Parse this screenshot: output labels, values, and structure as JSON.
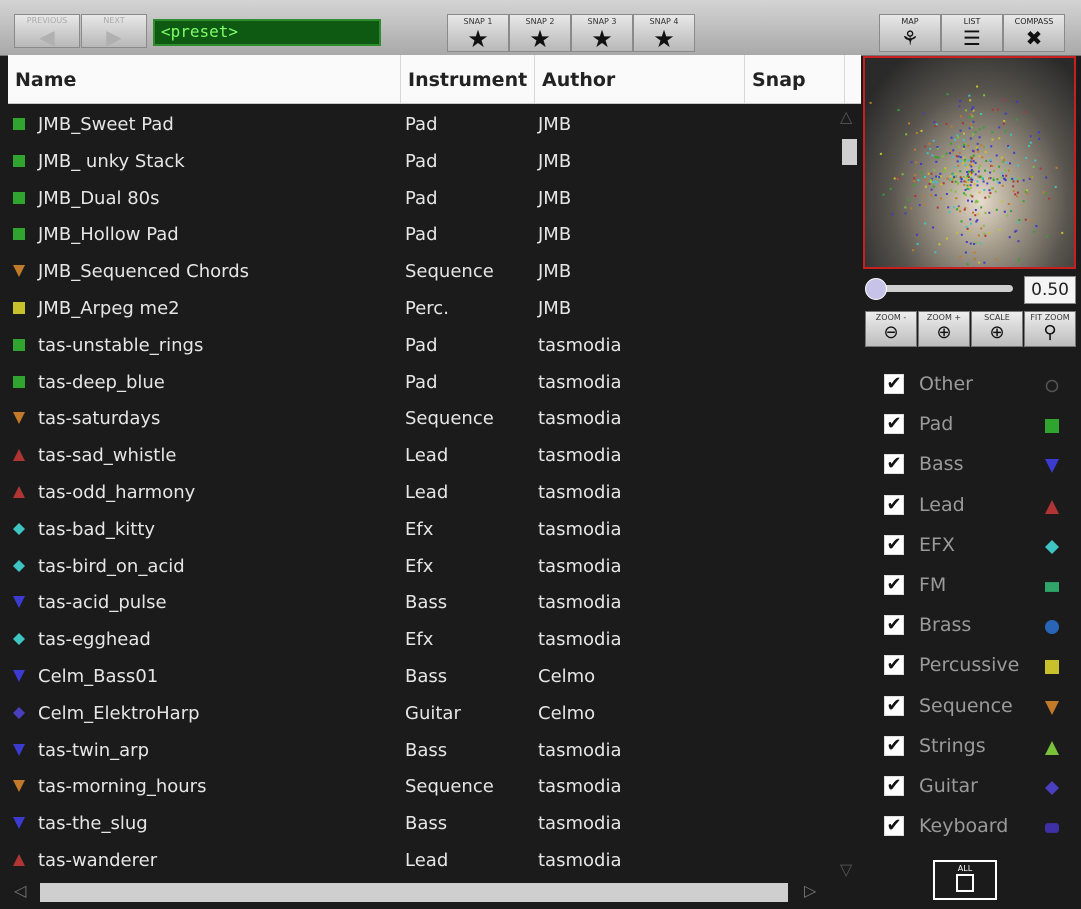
{
  "toolbar": {
    "previous_label": "PREVIOUS",
    "next_label": "NEXT",
    "preset_value": "<preset>",
    "snaps": [
      "SNAP 1",
      "SNAP 2",
      "SNAP 3",
      "SNAP 4"
    ],
    "views": [
      "MAP",
      "LIST",
      "COMPASS"
    ]
  },
  "table": {
    "headers": [
      "Name",
      "Instrument",
      "Author",
      "Snap"
    ],
    "rows": [
      {
        "name": "JMB_Sweet Pad",
        "instrument": "Pad",
        "author": "JMB",
        "marker": "pad"
      },
      {
        "name": "JMB_ unky Stack",
        "instrument": "Pad",
        "author": "JMB",
        "marker": "pad"
      },
      {
        "name": "JMB_Dual 80s",
        "instrument": "Pad",
        "author": "JMB",
        "marker": "pad"
      },
      {
        "name": "JMB_Hollow Pad",
        "instrument": "Pad",
        "author": "JMB",
        "marker": "pad"
      },
      {
        "name": "JMB_Sequenced Chords",
        "instrument": "Sequence",
        "author": "JMB",
        "marker": "sequence"
      },
      {
        "name": "JMB_Arpeg me2",
        "instrument": "Perc.",
        "author": "JMB",
        "marker": "percussive"
      },
      {
        "name": "tas-unstable_rings",
        "instrument": "Pad",
        "author": "tasmodia",
        "marker": "pad"
      },
      {
        "name": "tas-deep_blue",
        "instrument": "Pad",
        "author": "tasmodia",
        "marker": "pad"
      },
      {
        "name": "tas-saturdays",
        "instrument": "Sequence",
        "author": "tasmodia",
        "marker": "sequence"
      },
      {
        "name": "tas-sad_whistle",
        "instrument": "Lead",
        "author": "tasmodia",
        "marker": "lead"
      },
      {
        "name": "tas-odd_harmony",
        "instrument": "Lead",
        "author": "tasmodia",
        "marker": "lead"
      },
      {
        "name": "tas-bad_kitty",
        "instrument": "Efx",
        "author": "tasmodia",
        "marker": "efx"
      },
      {
        "name": "tas-bird_on_acid",
        "instrument": "Efx",
        "author": "tasmodia",
        "marker": "efx"
      },
      {
        "name": "tas-acid_pulse",
        "instrument": "Bass",
        "author": "tasmodia",
        "marker": "bass"
      },
      {
        "name": "tas-egghead",
        "instrument": "Efx",
        "author": "tasmodia",
        "marker": "efx"
      },
      {
        "name": "Celm_Bass01",
        "instrument": "Bass",
        "author": "Celmo",
        "marker": "bass"
      },
      {
        "name": "Celm_ElektroHarp",
        "instrument": "Guitar",
        "author": "Celmo",
        "marker": "guitar"
      },
      {
        "name": "tas-twin_arp",
        "instrument": "Bass",
        "author": "tasmodia",
        "marker": "bass"
      },
      {
        "name": "tas-morning_hours",
        "instrument": "Sequence",
        "author": "tasmodia",
        "marker": "sequence"
      },
      {
        "name": "tas-the_slug",
        "instrument": "Bass",
        "author": "tasmodia",
        "marker": "bass"
      },
      {
        "name": "tas-wanderer",
        "instrument": "Lead",
        "author": "tasmodia",
        "marker": "lead"
      }
    ]
  },
  "slider": {
    "value": "0.50",
    "fraction": 0.0
  },
  "zoom": [
    "ZOOM -",
    "ZOOM +",
    "SCALE",
    "FIT ZOOM"
  ],
  "filters": [
    {
      "label": "Other",
      "checked": true,
      "marker": "other"
    },
    {
      "label": "Pad",
      "checked": true,
      "marker": "pad"
    },
    {
      "label": "Bass",
      "checked": true,
      "marker": "bass"
    },
    {
      "label": "Lead",
      "checked": true,
      "marker": "lead"
    },
    {
      "label": "EFX",
      "checked": true,
      "marker": "efx"
    },
    {
      "label": "FM",
      "checked": true,
      "marker": "fm"
    },
    {
      "label": "Brass",
      "checked": true,
      "marker": "brass"
    },
    {
      "label": "Percussive",
      "checked": true,
      "marker": "percussive"
    },
    {
      "label": "Sequence",
      "checked": true,
      "marker": "sequence"
    },
    {
      "label": "Strings",
      "checked": true,
      "marker": "strings"
    },
    {
      "label": "Guitar",
      "checked": true,
      "marker": "guitar"
    },
    {
      "label": "Keyboard",
      "checked": true,
      "marker": "keyboard"
    }
  ],
  "all_label": "ALL",
  "marker_styles": {
    "other": {
      "shape": "circle-outline",
      "color": "#555555"
    },
    "pad": {
      "shape": "square",
      "color": "#2fa52f"
    },
    "bass": {
      "shape": "triangle-down",
      "color": "#3b3bd0"
    },
    "lead": {
      "shape": "triangle-up",
      "color": "#b03434"
    },
    "efx": {
      "shape": "diamond",
      "color": "#3fc4c4"
    },
    "fm": {
      "shape": "rect",
      "color": "#2fa56a"
    },
    "brass": {
      "shape": "circle",
      "color": "#2a64b8"
    },
    "percussive": {
      "shape": "square",
      "color": "#c9c12c"
    },
    "sequence": {
      "shape": "triangle-down",
      "color": "#c27a2a"
    },
    "strings": {
      "shape": "triangle-up",
      "color": "#7ac13a"
    },
    "guitar": {
      "shape": "diamond",
      "color": "#4a3fbf"
    },
    "keyboard": {
      "shape": "rounded-rect",
      "color": "#4030a8"
    }
  }
}
